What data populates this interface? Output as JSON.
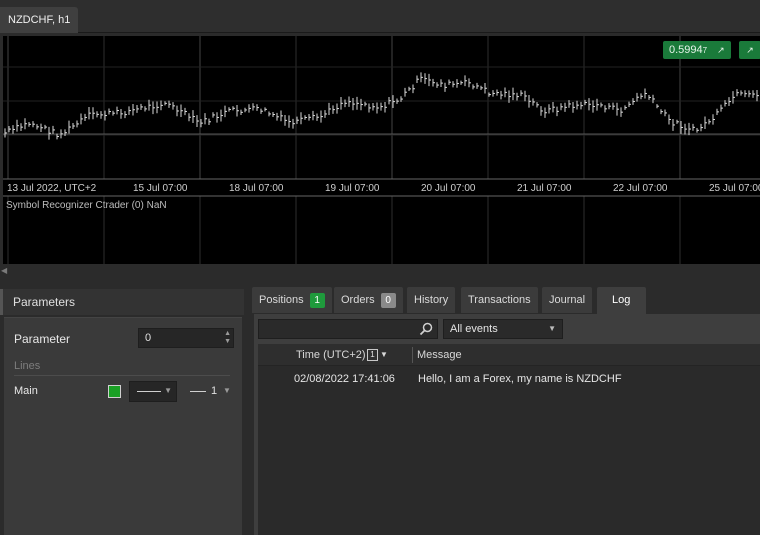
{
  "chart_tab": {
    "label": "NZDCHF, h1"
  },
  "chart": {
    "price_badge": {
      "main": "0.5994",
      "pip": "7"
    },
    "date_labels": [
      "13 Jul 2022, UTC+2",
      "15 Jul 07:00",
      "18 Jul 07:00",
      "19 Jul 07:00",
      "20 Jul 07:00",
      "21 Jul 07:00",
      "22 Jul 07:00",
      "25 Jul 07:00"
    ],
    "indicator_label": "Symbol Recognizer Ctrader (0) NaN",
    "colors": {
      "background": "#000000",
      "grid": "#333333",
      "candles": "#d9d9d9",
      "badge": "#1a7a3a"
    }
  },
  "parameters_panel": {
    "title": "Parameters",
    "parameter_label": "Parameter",
    "parameter_value": "0",
    "lines_label": "Lines",
    "main_label": "Main",
    "main_color": "#1aa025",
    "line_width": "1"
  },
  "tabs": [
    {
      "label": "Positions",
      "count": "1"
    },
    {
      "label": "Orders",
      "count": "0"
    },
    {
      "label": "History"
    },
    {
      "label": "Transactions"
    },
    {
      "label": "Journal"
    },
    {
      "label": "Log"
    }
  ],
  "log": {
    "filter_select": "All events",
    "columns": {
      "time": "Time (UTC+2)",
      "time_filter": "1",
      "message": "Message"
    },
    "rows": [
      {
        "time": "02/08/2022 17:41:06",
        "message": "Hello, I am a Forex, my name is NZDCHF"
      }
    ]
  }
}
